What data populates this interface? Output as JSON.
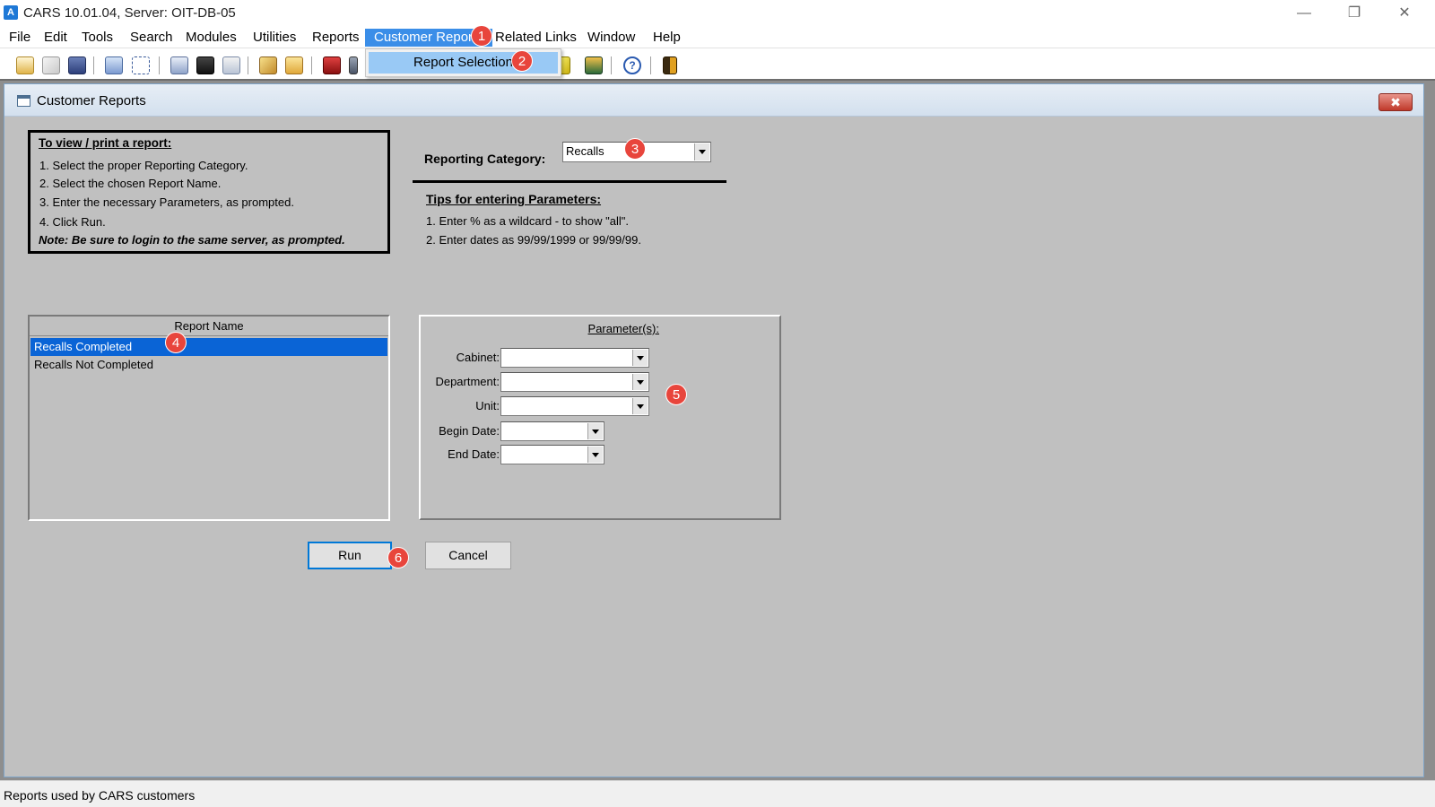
{
  "window": {
    "title": "CARS 10.01.04, Server: OIT-DB-05",
    "app_icon_glyph": "A",
    "minimize_glyph": "—",
    "restore_glyph": "❐",
    "close_glyph": "✕"
  },
  "menubar": {
    "items": [
      "File",
      "Edit",
      "Tools",
      "Search",
      "Modules",
      "Utilities",
      "Reports",
      "Customer Reports",
      "Related Links",
      "Window",
      "Help"
    ]
  },
  "dropdown": {
    "item": "Report Selection"
  },
  "toolbar": {
    "icons": [
      "new-icon",
      "edit-icon",
      "save-icon",
      "sort-icon",
      "zoom-icon",
      "print-icon",
      "calculator-icon",
      "preview-icon",
      "wrench-icon",
      "folder-icon",
      "car-icon",
      "building-icon",
      "pencil-icon",
      "book-icon",
      "help-icon",
      "exit-icon"
    ]
  },
  "child_window": {
    "title": "Customer Reports",
    "close_glyph": "✖"
  },
  "instructions": {
    "title": "To view / print a report:",
    "steps": [
      "1.  Select the proper Reporting Category.",
      "2.  Select the chosen Report Name.",
      "3.  Enter the necessary Parameters, as prompted.",
      "4.  Click Run."
    ],
    "note": "Note:  Be sure to login to the same server, as prompted."
  },
  "reporting_category": {
    "label": "Reporting Category:",
    "value": "Recalls"
  },
  "tips": {
    "title": "Tips for entering Parameters:",
    "items": [
      "1.  Enter % as a wildcard - to show \"all\".",
      "2.  Enter dates as  99/99/1999  or  99/99/99."
    ]
  },
  "report_list": {
    "header": "Report Name",
    "rows": [
      "Recalls Completed",
      "Recalls Not Completed"
    ],
    "selected_index": 0
  },
  "parameters": {
    "title": "Parameter(s):",
    "fields": [
      {
        "label": "Cabinet:",
        "value": ""
      },
      {
        "label": "Department:",
        "value": ""
      },
      {
        "label": "Unit:",
        "value": ""
      },
      {
        "label": "Begin Date:",
        "value": ""
      },
      {
        "label": "End Date:",
        "value": ""
      }
    ]
  },
  "buttons": {
    "run": "Run",
    "cancel": "Cancel"
  },
  "callouts": [
    "1",
    "2",
    "3",
    "4",
    "5",
    "6"
  ],
  "status": {
    "text": "Reports used by CARS customers"
  },
  "colors": {
    "accent": "#3b8ee8",
    "selection": "#0a64d6",
    "callout": "#e8453c",
    "panel": "#c0c0c0"
  }
}
